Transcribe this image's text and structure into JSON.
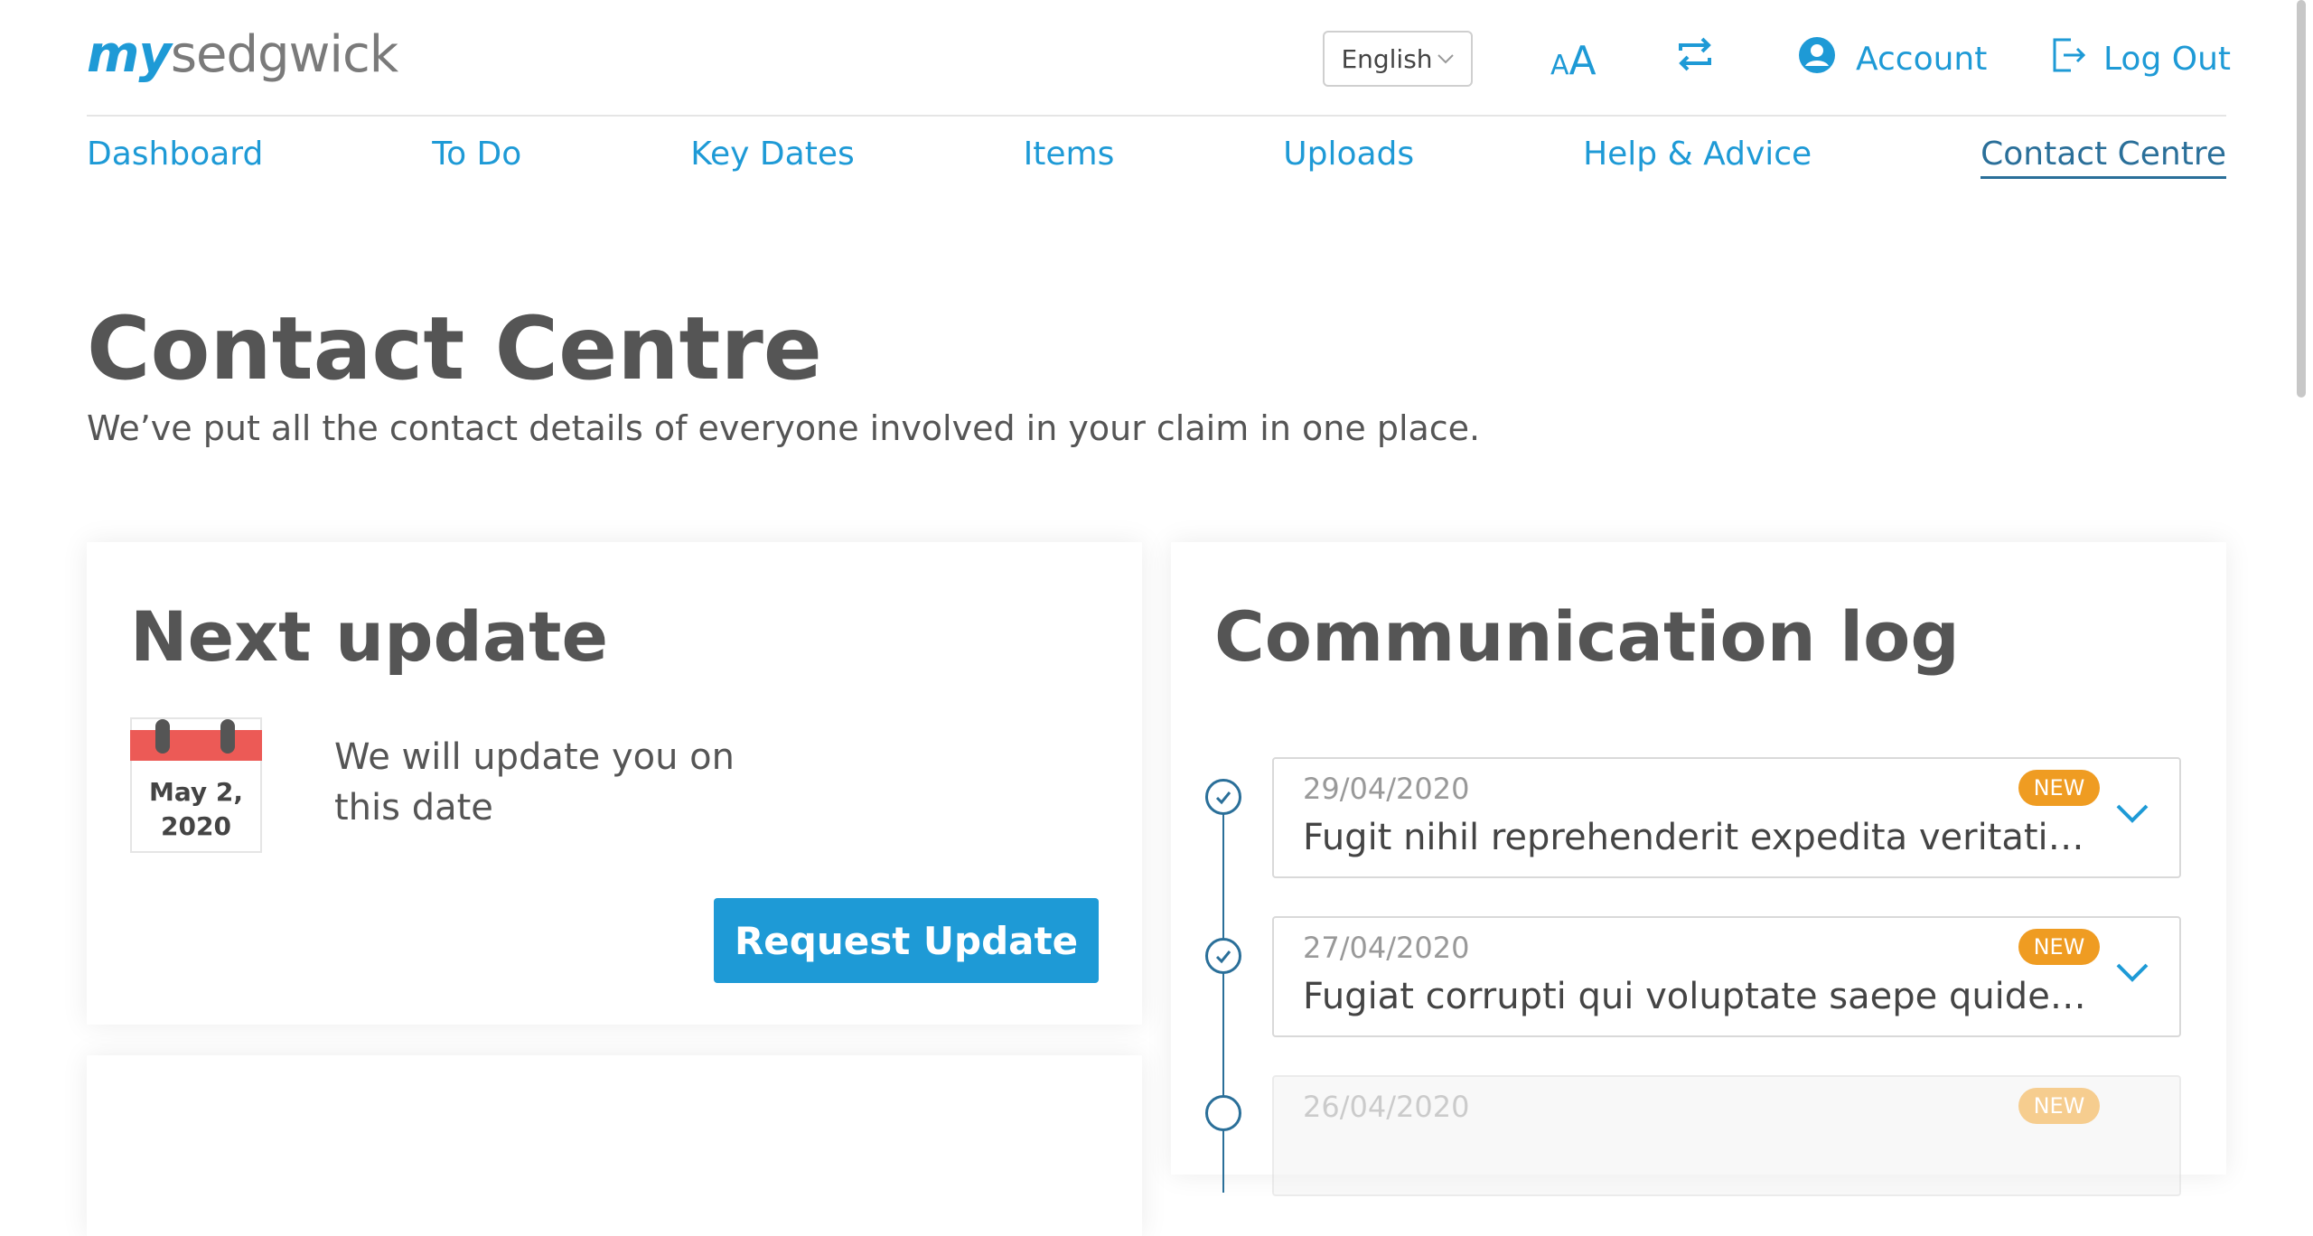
{
  "header": {
    "logo_my": "my",
    "logo_brand": "sedgwick",
    "language": "English",
    "font_size_small": "A",
    "font_size_large": "A",
    "account_label": "Account",
    "logout_label": "Log Out"
  },
  "nav": {
    "items": [
      {
        "label": "Dashboard"
      },
      {
        "label": "To Do"
      },
      {
        "label": "Key Dates"
      },
      {
        "label": "Items"
      },
      {
        "label": "Uploads"
      },
      {
        "label": "Help & Advice"
      },
      {
        "label": "Contact Centre"
      }
    ],
    "active": "Contact Centre"
  },
  "page": {
    "title": "Contact Centre",
    "subtitle": "We’ve put all the contact details of everyone involved in your claim in one place."
  },
  "next_update": {
    "title": "Next update",
    "calendar_date_line1": "May 2,",
    "calendar_date_line2": "2020",
    "text": "We will update you on this date",
    "button_label": "Request Update"
  },
  "communication_log": {
    "title": "Communication log",
    "items": [
      {
        "date": "29/04/2020",
        "badge": "NEW",
        "text": "Fugit nihil reprehenderit expedita veritatis c..."
      },
      {
        "date": "27/04/2020",
        "badge": "NEW",
        "text": "Fugiat corrupti qui voluptate saepe quidem ..."
      },
      {
        "date": "26/04/2020",
        "badge": "NEW",
        "text": ""
      }
    ]
  },
  "colors": {
    "accent": "#1e9ad6",
    "active_nav": "#2a6f99",
    "badge": "#ef9c22",
    "calendar_red": "#ec5a56"
  },
  "icons": {
    "font_size": "font-size-icon",
    "switch": "switch-view-icon",
    "account": "account-icon",
    "logout": "logout-icon",
    "calendar": "calendar-icon",
    "expand": "chevron-down-icon",
    "timeline_node": "check-circle-icon"
  }
}
